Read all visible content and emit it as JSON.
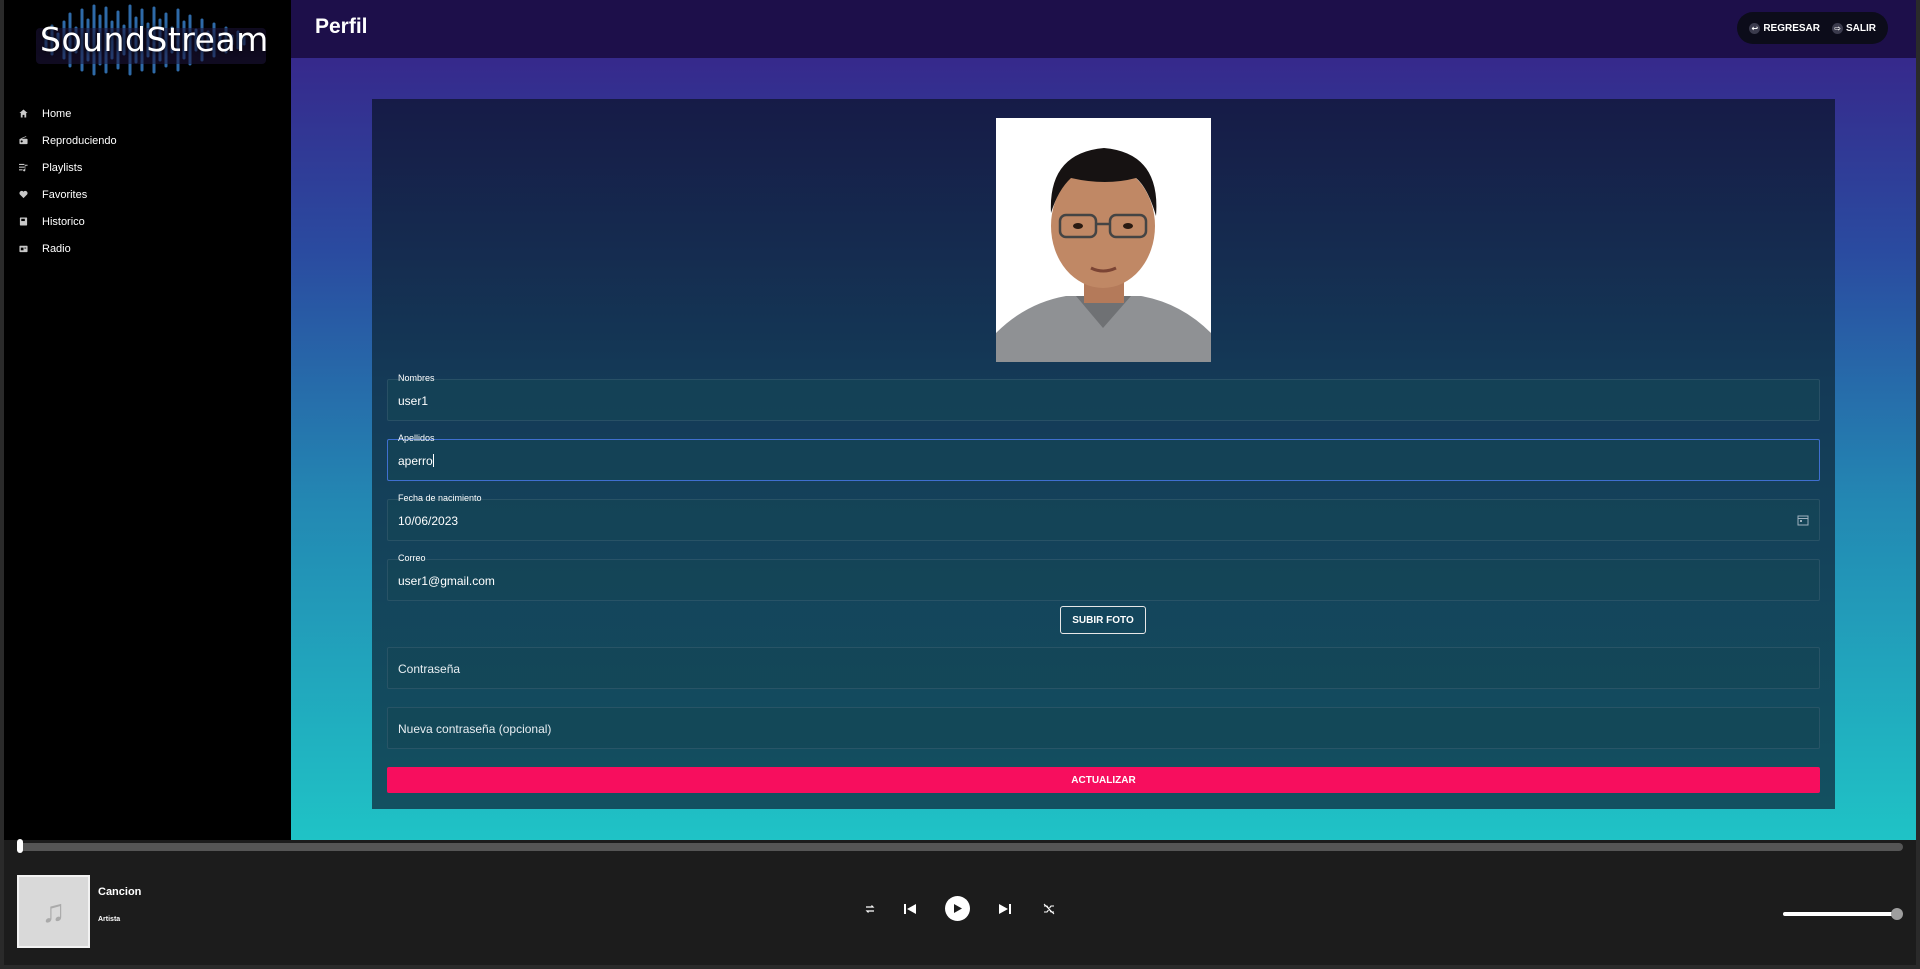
{
  "app": {
    "name": "SoundStream"
  },
  "sidebar": {
    "items": [
      {
        "label": "Home",
        "icon": "home-icon"
      },
      {
        "label": "Reproduciendo",
        "icon": "radio-icon"
      },
      {
        "label": "Playlists",
        "icon": "playlist-icon"
      },
      {
        "label": "Favorites",
        "icon": "heart-icon"
      },
      {
        "label": "Historico",
        "icon": "book-icon"
      },
      {
        "label": "Radio",
        "icon": "radio-box-icon"
      }
    ]
  },
  "header": {
    "title": "Perfil",
    "back_label": "REGRESAR",
    "logout_label": "SALIR"
  },
  "profile": {
    "photo_icon": "profile-photo",
    "fields": {
      "nombres": {
        "label": "Nombres",
        "value": "user1"
      },
      "apellidos": {
        "label": "Apellidos",
        "value": "aperro"
      },
      "fecha": {
        "label": "Fecha de nacimiento",
        "value": "10/06/2023"
      },
      "correo": {
        "label": "Correo",
        "value": "user1@gmail.com"
      },
      "password": {
        "placeholder": "Contraseña"
      },
      "new_password": {
        "placeholder": "Nueva contraseña (opcional)"
      }
    },
    "upload_label": "SUBIR FOTO",
    "update_label": "ACTUALIZAR"
  },
  "player": {
    "song": "Cancion",
    "artist": "Artista",
    "progress": 0,
    "volume": 0.93,
    "colors": {
      "accent": "#f70e5e",
      "header": "#1d0f4a"
    }
  }
}
